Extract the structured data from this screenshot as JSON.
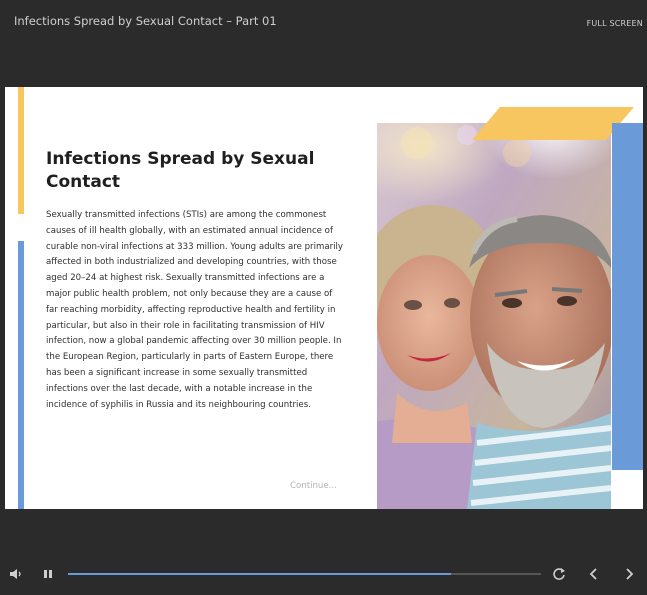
{
  "header": {
    "title": "Infections Spread by Sexual Contact – Part 01",
    "fullscreen_label": "FULL SCREEN"
  },
  "slide": {
    "heading": "Infections Spread by Sexual Contact",
    "body": "Sexually transmitted infections (STIs) are among the commonest causes of ill health globally, with an estimated annual incidence of curable non-viral infections at 333 million. Young adults are primarily affected in both industrialized and developing countries, with those aged 20–24 at highest risk. Sexually transmitted infections are a major public health problem, not only because they are a cause of far reaching morbidity, affecting reproductive health and fertility in particular, but also in their role in facilitating transmission of HIV infection, now a global pandemic affecting over 30 million people. In the European Region, particularly in parts of Eastern Europe, there has been a significant increase in some sexually transmitted infections over the last decade, with a notable increase in the incidence of syphilis in Russia and its neighbouring countries.",
    "continue_label": "Continue..."
  },
  "player": {
    "progress_fraction": 0.81,
    "icons": [
      "volume-icon",
      "pause-icon",
      "replay-icon",
      "previous-icon",
      "next-icon"
    ]
  },
  "colors": {
    "background": "#2b2b2b",
    "accent_yellow": "#f8c660",
    "accent_blue": "#6a9bd8"
  }
}
